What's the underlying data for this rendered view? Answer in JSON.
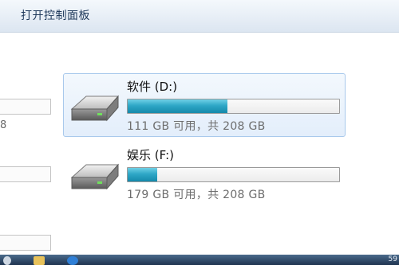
{
  "toolbar": {
    "open_control_panel": "打开控制面板"
  },
  "left_column": {
    "fragment_text": "8"
  },
  "drives": [
    {
      "name": "软件 (D:)",
      "free_text": "111 GB 可用，共 208 GB",
      "used_fraction": 0.47,
      "selected": true
    },
    {
      "name": "娱乐 (F:)",
      "free_text": "179 GB 可用，共 208 GB",
      "used_fraction": 0.14,
      "selected": false
    }
  ],
  "taskbar": {
    "time": "59"
  },
  "colors": {
    "usage_bar": "#2ea7c6",
    "selection_border": "#a9c9ec"
  }
}
